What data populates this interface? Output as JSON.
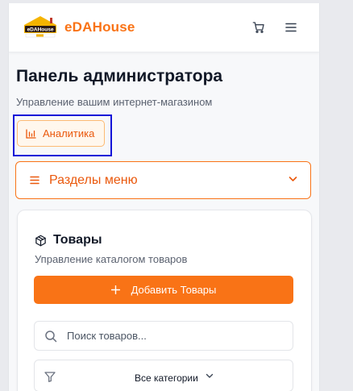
{
  "header": {
    "brand": "eDAHouse",
    "logo_text": "eDAHouse",
    "icons": {
      "cart": "cart-icon",
      "menu": "hamburger-menu-icon"
    }
  },
  "page": {
    "title": "Панель администратора",
    "subtitle": "Управление вашим интернет-магазином"
  },
  "analytics_button": {
    "label": "Аналитика",
    "icon": "bar-chart-icon"
  },
  "menu_sections": {
    "label": "Разделы меню",
    "icon": "lines-icon",
    "chevron": "chevron-down-icon"
  },
  "products_card": {
    "title": "Товары",
    "subtitle": "Управление каталогом товаров",
    "add_label": "Добавить Товары",
    "search_placeholder": "Поиск товаров...",
    "category_value": "Все категории"
  },
  "colors": {
    "accent": "#f97316",
    "accent_dark": "#ea580c",
    "highlight": "#1414d8",
    "background": "#f7f8fa"
  }
}
